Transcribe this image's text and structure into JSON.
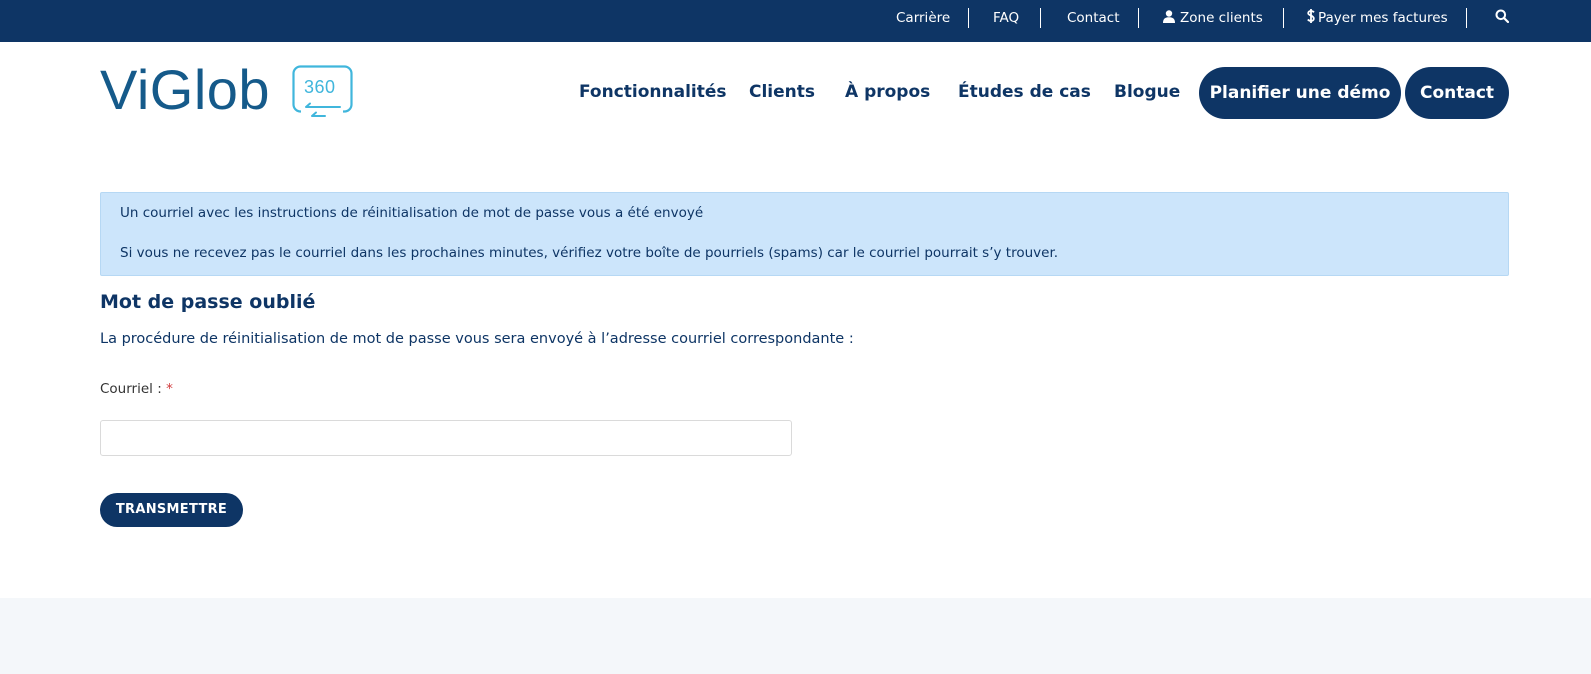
{
  "topbar": {
    "career": "Carrière",
    "faq": "FAQ",
    "contact": "Contact",
    "client_zone": "Zone clients",
    "pay_bills": "Payer mes factures",
    "search_icon": "search-icon",
    "user_icon": "user-icon",
    "dollar_icon": "dollar-icon"
  },
  "logo": {
    "wordmark": "ViGlob",
    "badge": "360"
  },
  "nav": {
    "features": "Fonctionnalités",
    "clients": "Clients",
    "about": "À propos",
    "case_studies": "Études de cas",
    "blog": "Blogue",
    "demo": "Planifier une démo",
    "contact": "Contact"
  },
  "alert": {
    "line1": "Un courriel avec les instructions de réinitialisation de mot de passe vous a été envoyé",
    "line2": "Si vous ne recevez pas le courriel dans les prochaines minutes, vérifiez votre boîte de pourriels (spams) car le courriel pourrait s’y trouver."
  },
  "form": {
    "title": "Mot de passe oublié",
    "description": "La procédure de réinitialisation de mot de passe vous sera envoyé à l’adresse courriel correspondante :",
    "email_label": "Courriel :",
    "required_mark": "*",
    "email_value": "",
    "submit": "TRANSMETTRE"
  },
  "colors": {
    "navy": "#0e3565",
    "logo_blue": "#155a8a",
    "logo_cyan": "#40b6dc",
    "alert_bg": "#cce5fb",
    "required": "#d0393b"
  }
}
